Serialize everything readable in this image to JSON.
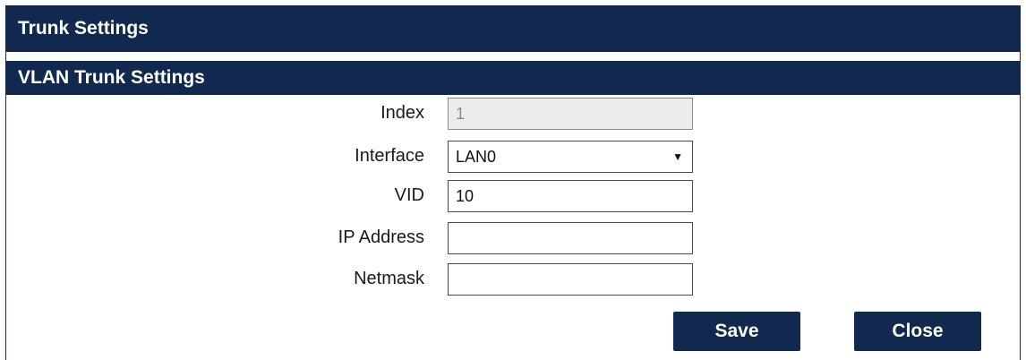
{
  "header": {
    "title": "Trunk Settings"
  },
  "section": {
    "title": "VLAN Trunk Settings"
  },
  "form": {
    "index": {
      "label": "Index",
      "value": "1"
    },
    "interface": {
      "label": "Interface",
      "value": "LAN0"
    },
    "vid": {
      "label": "VID",
      "value": "10"
    },
    "ip_address": {
      "label": "IP Address",
      "value": ""
    },
    "netmask": {
      "label": "Netmask",
      "value": ""
    }
  },
  "buttons": {
    "save_label": "Save",
    "close_label": "Close"
  },
  "colors": {
    "header_bg": "#11284f",
    "button_bg": "#11284f",
    "text_on_dark": "#ffffff"
  },
  "icons": {
    "dropdown": "chevron-down-icon"
  }
}
